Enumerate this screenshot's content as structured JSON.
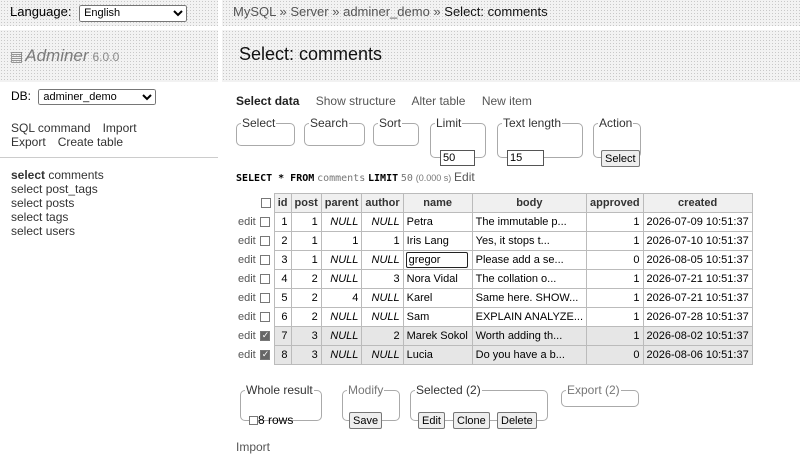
{
  "language": {
    "label": "Language:",
    "value": "English"
  },
  "logo": {
    "name": "Adminer",
    "version": "6.0.0"
  },
  "db": {
    "label": "DB:",
    "value": "adminer_demo"
  },
  "side_links": [
    "SQL command",
    "Import",
    "Export",
    "Create table"
  ],
  "tables": [
    {
      "prefix": "select",
      "name": "comments",
      "selected": true
    },
    {
      "prefix": "select",
      "name": "post_tags",
      "selected": false
    },
    {
      "prefix": "select",
      "name": "posts",
      "selected": false
    },
    {
      "prefix": "select",
      "name": "tags",
      "selected": false
    },
    {
      "prefix": "select",
      "name": "users",
      "selected": false
    }
  ],
  "breadcrumb": {
    "parts": [
      "MySQL",
      "Server",
      "adminer_demo"
    ],
    "sep": " » ",
    "current": "Select: comments"
  },
  "heading": "Select: comments",
  "subnav": {
    "current": "Select data",
    "links": [
      "Show structure",
      "Alter table",
      "New item"
    ]
  },
  "filters": {
    "select_legend": "Select",
    "search_legend": "Search",
    "sort_legend": "Sort",
    "limit_legend": "Limit",
    "limit_value": "50",
    "textlen_legend": "Text length",
    "textlen_value": "15",
    "action_legend": "Action",
    "action_button": "Select"
  },
  "query": {
    "kw1": "SELECT * FROM",
    "table": "comments",
    "kw2": "LIMIT",
    "limit": "50",
    "time": "(0.000 s)",
    "edit": "Edit"
  },
  "columns": [
    "id",
    "post",
    "parent",
    "author",
    "name",
    "body",
    "approved",
    "created"
  ],
  "rows": [
    {
      "edit": "edit",
      "checked": false,
      "id": "1",
      "post": "1",
      "parent": "NULL",
      "author": "NULL",
      "name": "Petra",
      "body": "The immutable p...",
      "approved": "1",
      "created": "2026-07-09 10:51:37"
    },
    {
      "edit": "edit",
      "checked": false,
      "id": "2",
      "post": "1",
      "parent": "1",
      "author": "1",
      "name": "Iris Lang",
      "body": "Yes, it stops t...",
      "approved": "1",
      "created": "2026-07-10 10:51:37"
    },
    {
      "edit": "edit",
      "checked": false,
      "id": "3",
      "post": "1",
      "parent": "NULL",
      "author": "NULL",
      "name": "gregor",
      "body": "Please add a se...",
      "approved": "0",
      "created": "2026-08-05 10:51:37",
      "editing": true
    },
    {
      "edit": "edit",
      "checked": false,
      "id": "4",
      "post": "2",
      "parent": "NULL",
      "author": "3",
      "name": "Nora Vidal",
      "body": "The collation o...",
      "approved": "1",
      "created": "2026-07-21 10:51:37"
    },
    {
      "edit": "edit",
      "checked": false,
      "id": "5",
      "post": "2",
      "parent": "4",
      "author": "NULL",
      "name": "Karel",
      "body": "Same here. SHOW...",
      "approved": "1",
      "created": "2026-07-21 10:51:37"
    },
    {
      "edit": "edit",
      "checked": false,
      "id": "6",
      "post": "2",
      "parent": "NULL",
      "author": "NULL",
      "name": "Sam",
      "body": "EXPLAIN ANALYZE...",
      "approved": "1",
      "created": "2026-07-28 10:51:37"
    },
    {
      "edit": "edit",
      "checked": true,
      "id": "7",
      "post": "3",
      "parent": "NULL",
      "author": "2",
      "name": "Marek Sokol",
      "body": "Worth adding th...",
      "approved": "1",
      "created": "2026-08-02 10:51:37"
    },
    {
      "edit": "edit",
      "checked": true,
      "id": "8",
      "post": "3",
      "parent": "NULL",
      "author": "NULL",
      "name": "Lucia",
      "body": "Do you have a b...",
      "approved": "0",
      "created": "2026-08-06 10:51:37"
    }
  ],
  "footer": {
    "whole_legend": "Whole result",
    "whole_rows": "8 rows",
    "modify_legend": "Modify",
    "save": "Save",
    "selected_legend": "Selected (2)",
    "edit": "Edit",
    "clone": "Clone",
    "delete": "Delete",
    "export_legend": "Export (2)"
  },
  "import": "Import"
}
